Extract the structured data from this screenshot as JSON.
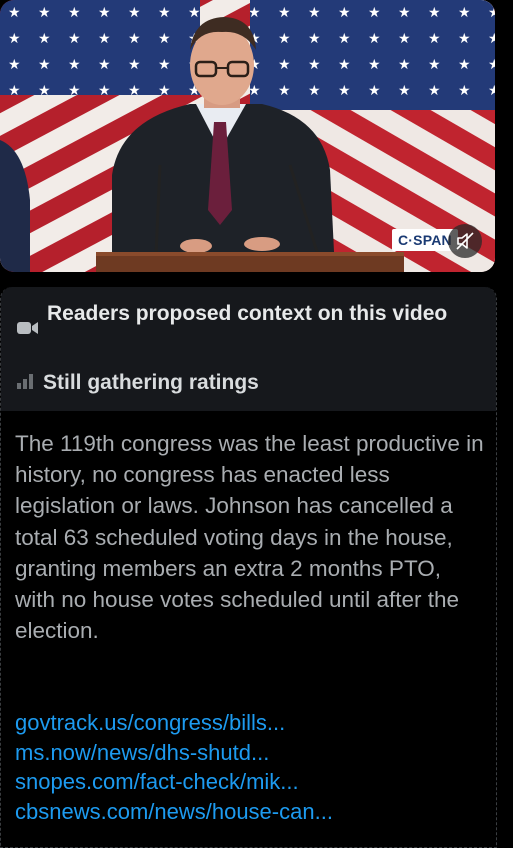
{
  "video": {
    "badge": "C·SPAN",
    "mute_icon": "speaker-muted-icon"
  },
  "note": {
    "icon": "video-camera-icon",
    "title": "Readers proposed context on this video",
    "status_icon": "signal-bars-icon",
    "status": "Still gathering ratings",
    "body": "The 119th congress was the least productive in history, no congress has enacted less legislation or laws. Johnson has cancelled a total 63 scheduled voting days in the house, granting members an extra 2 months PTO, with no house votes scheduled until after the election.",
    "links": [
      "govtrack.us/congress/bills...",
      "ms.now/news/dhs-shutd...",
      "snopes.com/fact-check/mik...",
      "cbsnews.com/news/house-can..."
    ]
  },
  "colors": {
    "link": "#1d9bf0",
    "header_bg": "#16181c",
    "body_text": "#a9adb1"
  }
}
